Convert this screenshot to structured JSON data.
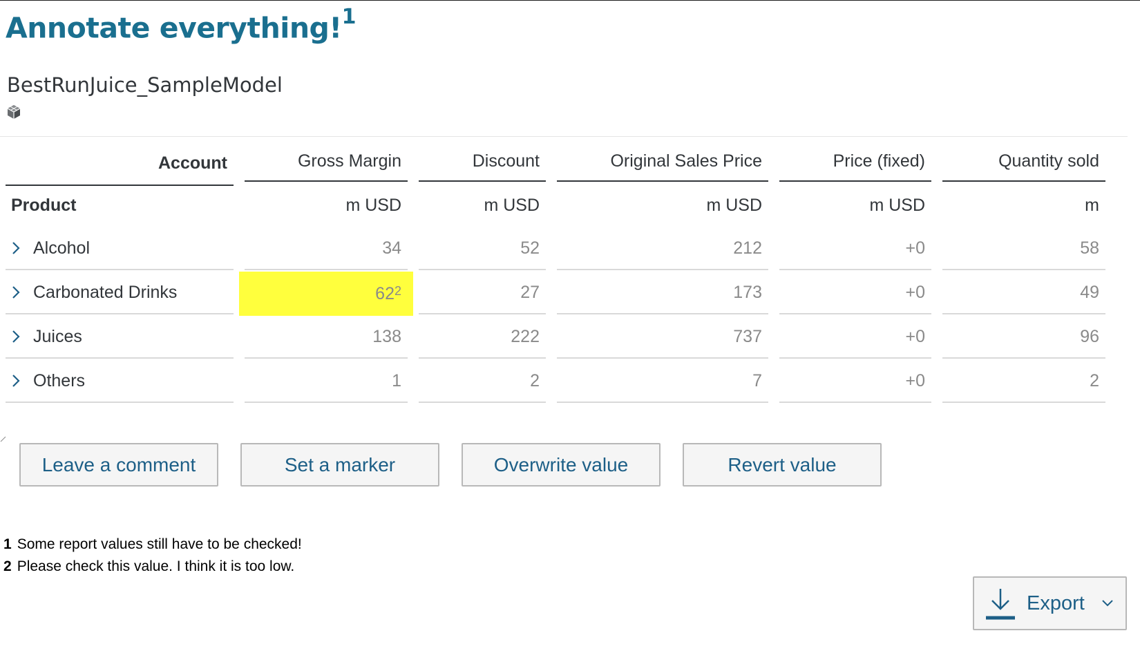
{
  "title": {
    "text": "Annotate everything!",
    "footnote_ref": "1"
  },
  "model": {
    "name": "BestRunJuice_SampleModel",
    "icon": "cube-icon"
  },
  "table": {
    "account_label": "Account",
    "product_label": "Product",
    "columns": [
      {
        "name": "Gross Margin",
        "unit": "m USD"
      },
      {
        "name": "Discount",
        "unit": "m USD"
      },
      {
        "name": "Original Sales Price",
        "unit": "m USD"
      },
      {
        "name": "Price (fixed)",
        "unit": "m USD"
      },
      {
        "name": "Quantity sold",
        "unit": "m"
      }
    ],
    "rows": [
      {
        "label": "Alcohol",
        "values": [
          "34",
          "52",
          "212",
          "+0",
          "58"
        ]
      },
      {
        "label": "Carbonated Drinks",
        "values": [
          "62",
          "27",
          "173",
          "+0",
          "49"
        ],
        "annotation": "2"
      },
      {
        "label": "Juices",
        "values": [
          "138",
          "222",
          "737",
          "+0",
          "96"
        ]
      },
      {
        "label": "Others",
        "values": [
          "1",
          "2",
          "7",
          "+0",
          "2"
        ]
      }
    ],
    "highlight_color": "#ffff3d",
    "expand_icon": "chevron-right-icon"
  },
  "buttons": {
    "leave_comment": "Leave a comment",
    "set_marker": "Set a marker",
    "overwrite_value": "Overwrite value",
    "revert_value": "Revert value"
  },
  "footnotes": [
    {
      "number": "1",
      "text": "Some report values still have to be checked!"
    },
    {
      "number": "2",
      "text": "Please check this value. I think it is too low."
    }
  ],
  "export": {
    "label": "Export",
    "icon": "download-icon",
    "dropdown_icon": "chevron-down-icon"
  },
  "colors": {
    "title": "#1a6f8f",
    "button_text": "#1d5f87",
    "value_text": "#8a8a8a"
  }
}
